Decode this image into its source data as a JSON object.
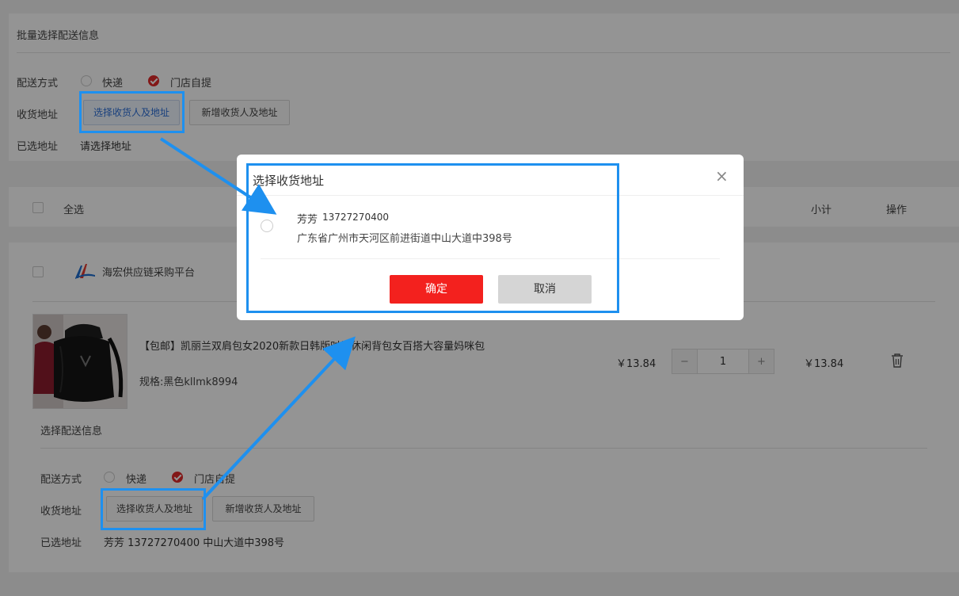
{
  "batch": {
    "title": "批量选择配送信息",
    "method_label": "配送方式",
    "option_express": "快递",
    "option_pickup": "门店自提",
    "address_label": "收货地址",
    "select_button": "选择收货人及地址",
    "new_button": "新增收货人及地址",
    "selected_label": "已选地址",
    "selected_value": "请选择地址"
  },
  "cart_header": {
    "select_all": "全选",
    "subtotal": "小计",
    "actions": "操作"
  },
  "store": {
    "name": "海宏供应链采购平台"
  },
  "product": {
    "title": "【包邮】凯丽兰双肩包女2020新款日韩版时尚休闲背包女百搭大容量妈咪包",
    "spec": "规格:黑色kllmk8994",
    "price": "￥13.84",
    "quantity": "1",
    "minus": "−",
    "plus": "+",
    "subtotal": "￥13.84"
  },
  "item_delivery": {
    "title": "选择配送信息",
    "method_label": "配送方式",
    "option_express": "快递",
    "option_pickup": "门店自提",
    "address_label": "收货地址",
    "select_button": "选择收货人及地址",
    "new_button": "新增收货人及地址",
    "selected_label": "已选地址",
    "selected_value": "芳芳 13727270400 中山大道中398号"
  },
  "modal": {
    "title": "选择收货地址",
    "close": "×",
    "address_name": "芳芳",
    "address_phone": "13727270400",
    "address_detail": "广东省广州市天河区前进街道中山大道中398号",
    "confirm": "确定",
    "cancel": "取消"
  },
  "colors": {
    "accent_red": "#f3211e",
    "highlight_blue": "#1e90ef"
  },
  "icons": {
    "delete": "trash-icon",
    "close": "close-icon",
    "store_logo": "store-logo-icon"
  }
}
